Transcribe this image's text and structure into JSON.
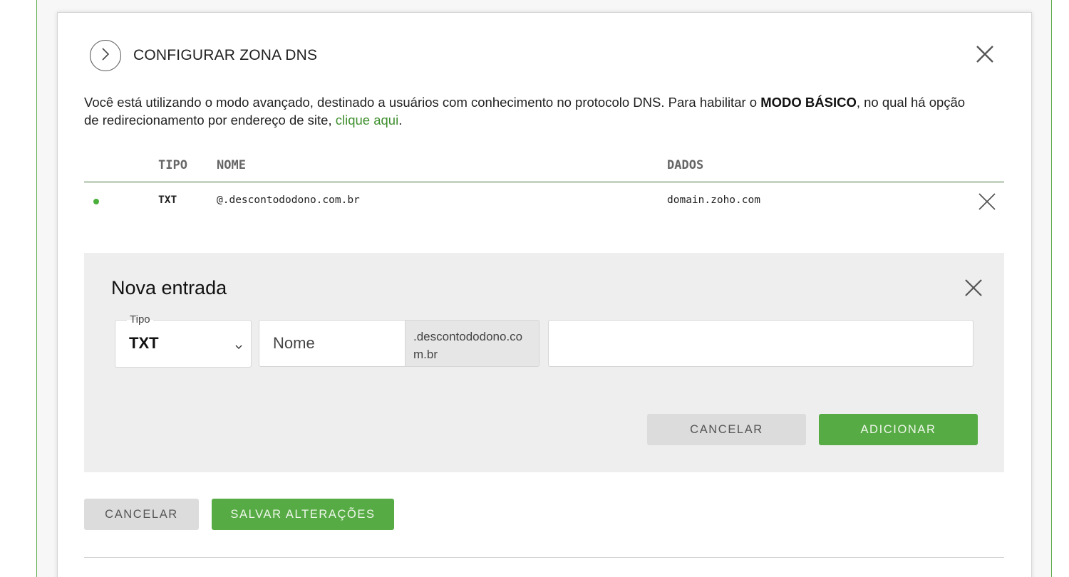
{
  "modal": {
    "title": "CONFIGURAR ZONA DNS",
    "intro_before": "Você está utilizando o modo avançado, destinado a usuários com conhecimento no protocolo DNS. Para habilitar o ",
    "intro_bold": "MODO BÁSICO",
    "intro_after": ", no qual há opção de redirecionamento por endereço de site, ",
    "intro_link": "clique aqui",
    "intro_end": "."
  },
  "table": {
    "columns": [
      "TIPO",
      "NOME",
      "DADOS"
    ],
    "rows": [
      {
        "status_color": "#4caf3c",
        "tipo": "TXT",
        "nome": "@.descontododono.com.br",
        "dados": "domain.zoho.com"
      }
    ]
  },
  "new_entry": {
    "title": "Nova entrada",
    "type_label": "Tipo",
    "type_value": "TXT",
    "name_placeholder": "Nome",
    "name_value": "",
    "domain_suffix": ".descontododono.com.br",
    "data_value": "",
    "cancel_label": "CANCELAR",
    "add_label": "ADICIONAR"
  },
  "footer": {
    "cancel_label": "CANCELAR",
    "save_label": "SALVAR ALTERAÇÕES"
  },
  "colors": {
    "accent_green": "#57ab45",
    "link_green": "#3f8f2e",
    "status_green": "#4caf3c"
  },
  "icons": {
    "toggle": "chevron-right-icon",
    "modal_close": "close-icon",
    "row_delete": "close-icon",
    "new_entry_close": "close-icon",
    "type_select": "chevron-down-icon"
  }
}
